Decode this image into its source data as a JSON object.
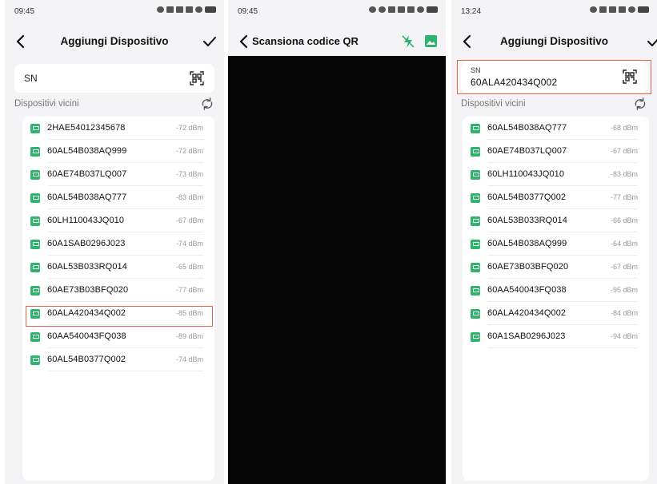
{
  "screens": [
    {
      "time": "09:45",
      "title": "Aggiungi Dispositivo",
      "sn_label": "SN",
      "section_label": "Dispositivi vicini",
      "devices": [
        {
          "sn": "2HAE54012345678",
          "rssi": "-72 dBm"
        },
        {
          "sn": "60AL54B038AQ999",
          "rssi": "-72 dBm"
        },
        {
          "sn": "60AE74B037LQ007",
          "rssi": "-73 dBm"
        },
        {
          "sn": "60AL54B038AQ777",
          "rssi": "-83 dBm"
        },
        {
          "sn": "60LH110043JQ010",
          "rssi": "-67 dBm"
        },
        {
          "sn": "60A1SAB0296J023",
          "rssi": "-74 dBm"
        },
        {
          "sn": "60AL53B033RQ014",
          "rssi": "-65 dBm"
        },
        {
          "sn": "60AE73B03BFQ020",
          "rssi": "-77 dBm"
        },
        {
          "sn": "60ALA420434Q002",
          "rssi": "-85 dBm",
          "highlighted": true
        },
        {
          "sn": "60AA540043FQ038",
          "rssi": "-89 dBm"
        },
        {
          "sn": "60AL54B0377Q002",
          "rssi": "-74 dBm"
        }
      ]
    },
    {
      "time": "09:45",
      "title": "Scansiona codice QR"
    },
    {
      "time": "13:24",
      "title": "Aggiungi Dispositivo",
      "sn_label": "SN",
      "sn_value": "60ALA420434Q002",
      "section_label": "Dispositivi vicini",
      "devices": [
        {
          "sn": "60AL54B038AQ777",
          "rssi": "-68 dBm"
        },
        {
          "sn": "60AE74B037LQ007",
          "rssi": "-67 dBm"
        },
        {
          "sn": "60LH110043JQ010",
          "rssi": "-83 dBm"
        },
        {
          "sn": "60AL54B0377Q002",
          "rssi": "-77 dBm"
        },
        {
          "sn": "60AL53B033RQ014",
          "rssi": "-66 dBm"
        },
        {
          "sn": "60AL54B038AQ999",
          "rssi": "-64 dBm"
        },
        {
          "sn": "60AE73B03BFQ020",
          "rssi": "-67 dBm"
        },
        {
          "sn": "60AA540043FQ038",
          "rssi": "-95 dBm"
        },
        {
          "sn": "60ALA420434Q002",
          "rssi": "-84 dBm"
        },
        {
          "sn": "60A1SAB0296J023",
          "rssi": "-94 dBm"
        }
      ]
    }
  ],
  "colors": {
    "device_icon": "#2fb56b",
    "highlight": "#e2654a",
    "camera_bg": "#050505",
    "background": "#f4f4f6"
  },
  "icons": [
    "back-arrow-icon",
    "check-icon",
    "qr-scan-icon",
    "refresh-icon",
    "device-icon",
    "flash-off-icon",
    "gallery-icon"
  ]
}
